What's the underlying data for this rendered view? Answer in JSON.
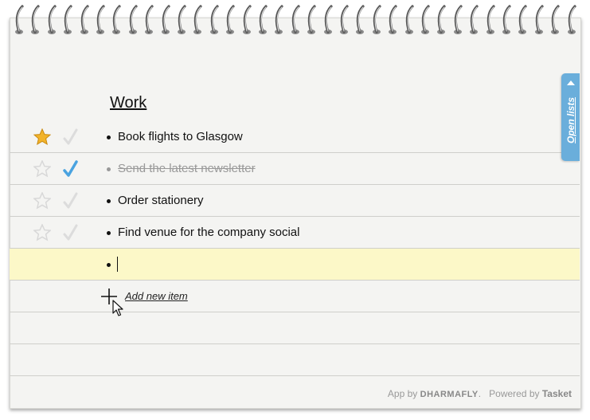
{
  "list": {
    "title": "Work",
    "items": [
      {
        "text": "Book flights to Glasgow",
        "starred": true,
        "done": false
      },
      {
        "text": "Send the latest newsletter",
        "starred": false,
        "done": true
      },
      {
        "text": "Order stationery",
        "starred": false,
        "done": false
      },
      {
        "text": "Find venue for the company social",
        "starred": false,
        "done": false
      }
    ],
    "new_item_value": "",
    "add_label": "Add new item"
  },
  "sidebar_tab": {
    "label": "Open lists"
  },
  "footer": {
    "app_by": "App by",
    "app_brand": "DHARMAFLY",
    "powered_by": "Powered by",
    "powered_brand": "Tasket"
  },
  "colors": {
    "paper": "#f4f4f2",
    "rule_line": "#cfcfcb",
    "current_row": "#fcf8c8",
    "tab_blue": "#6aaedb",
    "star_gold": "#f2b32a",
    "check_blue": "#4aa3e0"
  }
}
